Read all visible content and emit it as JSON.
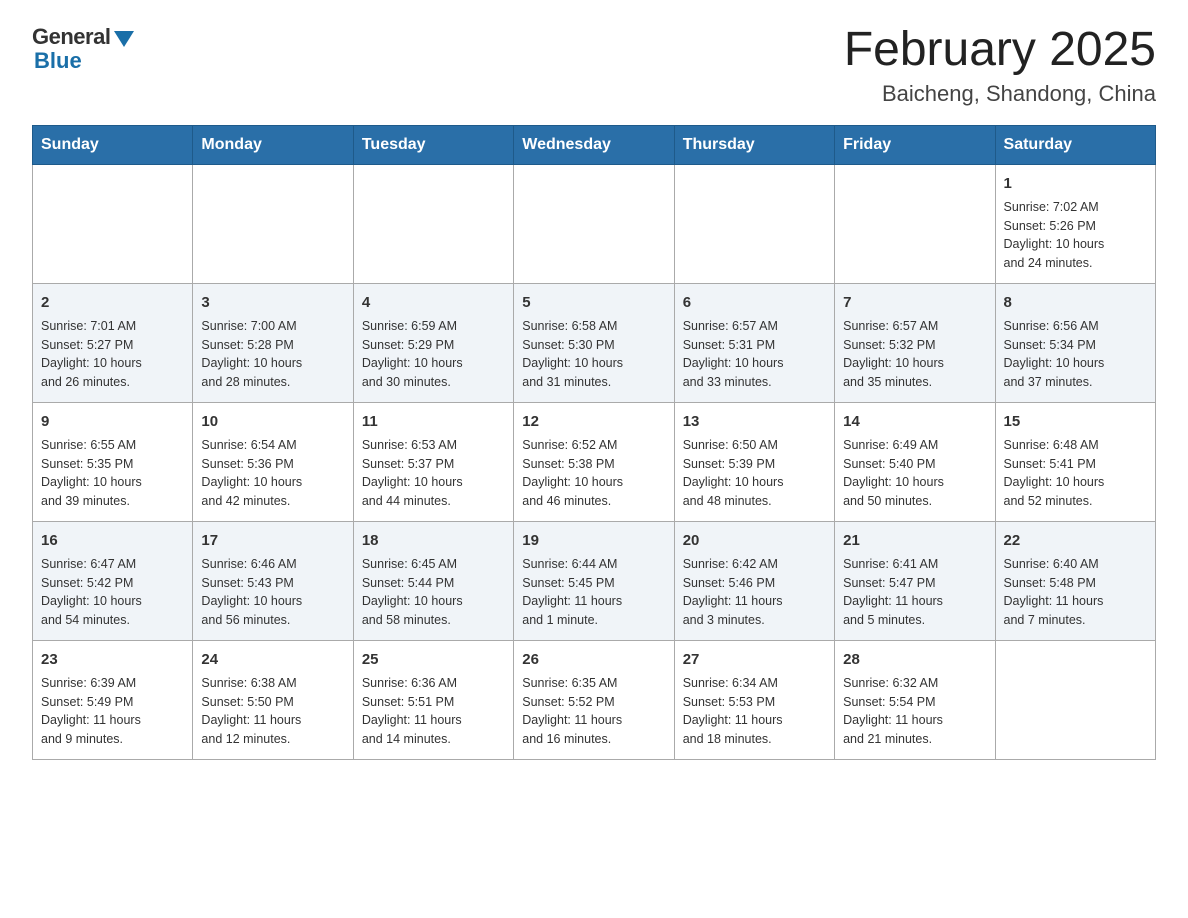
{
  "header": {
    "logo_general": "General",
    "logo_blue": "Blue",
    "month_title": "February 2025",
    "location": "Baicheng, Shandong, China"
  },
  "days_of_week": [
    "Sunday",
    "Monday",
    "Tuesday",
    "Wednesday",
    "Thursday",
    "Friday",
    "Saturday"
  ],
  "weeks": [
    [
      {
        "day": "",
        "info": ""
      },
      {
        "day": "",
        "info": ""
      },
      {
        "day": "",
        "info": ""
      },
      {
        "day": "",
        "info": ""
      },
      {
        "day": "",
        "info": ""
      },
      {
        "day": "",
        "info": ""
      },
      {
        "day": "1",
        "info": "Sunrise: 7:02 AM\nSunset: 5:26 PM\nDaylight: 10 hours\nand 24 minutes."
      }
    ],
    [
      {
        "day": "2",
        "info": "Sunrise: 7:01 AM\nSunset: 5:27 PM\nDaylight: 10 hours\nand 26 minutes."
      },
      {
        "day": "3",
        "info": "Sunrise: 7:00 AM\nSunset: 5:28 PM\nDaylight: 10 hours\nand 28 minutes."
      },
      {
        "day": "4",
        "info": "Sunrise: 6:59 AM\nSunset: 5:29 PM\nDaylight: 10 hours\nand 30 minutes."
      },
      {
        "day": "5",
        "info": "Sunrise: 6:58 AM\nSunset: 5:30 PM\nDaylight: 10 hours\nand 31 minutes."
      },
      {
        "day": "6",
        "info": "Sunrise: 6:57 AM\nSunset: 5:31 PM\nDaylight: 10 hours\nand 33 minutes."
      },
      {
        "day": "7",
        "info": "Sunrise: 6:57 AM\nSunset: 5:32 PM\nDaylight: 10 hours\nand 35 minutes."
      },
      {
        "day": "8",
        "info": "Sunrise: 6:56 AM\nSunset: 5:34 PM\nDaylight: 10 hours\nand 37 minutes."
      }
    ],
    [
      {
        "day": "9",
        "info": "Sunrise: 6:55 AM\nSunset: 5:35 PM\nDaylight: 10 hours\nand 39 minutes."
      },
      {
        "day": "10",
        "info": "Sunrise: 6:54 AM\nSunset: 5:36 PM\nDaylight: 10 hours\nand 42 minutes."
      },
      {
        "day": "11",
        "info": "Sunrise: 6:53 AM\nSunset: 5:37 PM\nDaylight: 10 hours\nand 44 minutes."
      },
      {
        "day": "12",
        "info": "Sunrise: 6:52 AM\nSunset: 5:38 PM\nDaylight: 10 hours\nand 46 minutes."
      },
      {
        "day": "13",
        "info": "Sunrise: 6:50 AM\nSunset: 5:39 PM\nDaylight: 10 hours\nand 48 minutes."
      },
      {
        "day": "14",
        "info": "Sunrise: 6:49 AM\nSunset: 5:40 PM\nDaylight: 10 hours\nand 50 minutes."
      },
      {
        "day": "15",
        "info": "Sunrise: 6:48 AM\nSunset: 5:41 PM\nDaylight: 10 hours\nand 52 minutes."
      }
    ],
    [
      {
        "day": "16",
        "info": "Sunrise: 6:47 AM\nSunset: 5:42 PM\nDaylight: 10 hours\nand 54 minutes."
      },
      {
        "day": "17",
        "info": "Sunrise: 6:46 AM\nSunset: 5:43 PM\nDaylight: 10 hours\nand 56 minutes."
      },
      {
        "day": "18",
        "info": "Sunrise: 6:45 AM\nSunset: 5:44 PM\nDaylight: 10 hours\nand 58 minutes."
      },
      {
        "day": "19",
        "info": "Sunrise: 6:44 AM\nSunset: 5:45 PM\nDaylight: 11 hours\nand 1 minute."
      },
      {
        "day": "20",
        "info": "Sunrise: 6:42 AM\nSunset: 5:46 PM\nDaylight: 11 hours\nand 3 minutes."
      },
      {
        "day": "21",
        "info": "Sunrise: 6:41 AM\nSunset: 5:47 PM\nDaylight: 11 hours\nand 5 minutes."
      },
      {
        "day": "22",
        "info": "Sunrise: 6:40 AM\nSunset: 5:48 PM\nDaylight: 11 hours\nand 7 minutes."
      }
    ],
    [
      {
        "day": "23",
        "info": "Sunrise: 6:39 AM\nSunset: 5:49 PM\nDaylight: 11 hours\nand 9 minutes."
      },
      {
        "day": "24",
        "info": "Sunrise: 6:38 AM\nSunset: 5:50 PM\nDaylight: 11 hours\nand 12 minutes."
      },
      {
        "day": "25",
        "info": "Sunrise: 6:36 AM\nSunset: 5:51 PM\nDaylight: 11 hours\nand 14 minutes."
      },
      {
        "day": "26",
        "info": "Sunrise: 6:35 AM\nSunset: 5:52 PM\nDaylight: 11 hours\nand 16 minutes."
      },
      {
        "day": "27",
        "info": "Sunrise: 6:34 AM\nSunset: 5:53 PM\nDaylight: 11 hours\nand 18 minutes."
      },
      {
        "day": "28",
        "info": "Sunrise: 6:32 AM\nSunset: 5:54 PM\nDaylight: 11 hours\nand 21 minutes."
      },
      {
        "day": "",
        "info": ""
      }
    ]
  ]
}
